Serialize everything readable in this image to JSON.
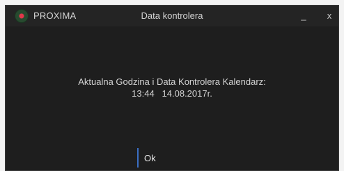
{
  "app": {
    "name": "PROXIMA",
    "logo_icon": "proxima-logo-icon"
  },
  "window": {
    "title": "Data kontrolera",
    "minimize_label": "_",
    "close_label": "x"
  },
  "message": {
    "line1": "Aktualna Godzina i Data Kontrolera Kalendarz:",
    "line2": "13:44   14.08.2017r."
  },
  "buttons": {
    "ok_label": "Ok"
  },
  "colors": {
    "background": "#1e1e1e",
    "titlebar": "#242424",
    "text": "#d4d4d4",
    "accent": "#3b6fc4",
    "logo_red": "#e0384a",
    "logo_green": "#274a2f"
  }
}
